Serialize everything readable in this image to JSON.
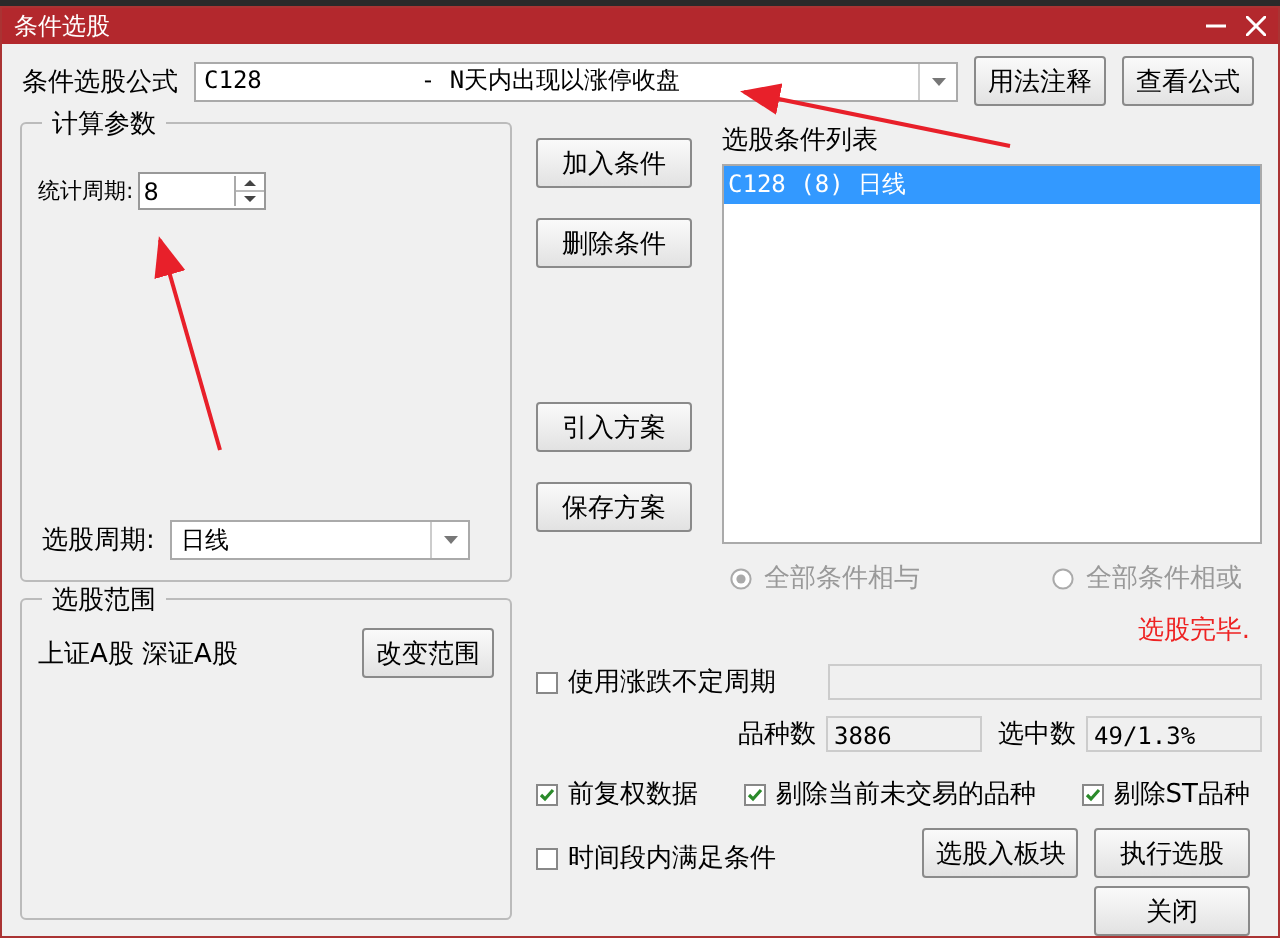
{
  "window": {
    "title": "条件选股"
  },
  "formula": {
    "label": "条件选股公式",
    "value": "C128           - N天内出现以涨停收盘",
    "buttons": [
      "用法注释",
      "查看公式"
    ]
  },
  "params": {
    "title": "计算参数",
    "fields": [
      {
        "label": "统计周期:",
        "value": "8"
      }
    ],
    "period": {
      "label": "选股周期:",
      "value": "日线"
    }
  },
  "scope": {
    "title": "选股范围",
    "text": "上证A股 深证A股",
    "button": "改变范围"
  },
  "actions": [
    "加入条件",
    "删除条件",
    "引入方案",
    "保存方案"
  ],
  "conditions": {
    "title": "选股条件列表",
    "items": [
      {
        "text": "C128 (8) 日线",
        "selected": true
      }
    ]
  },
  "logic": [
    {
      "label": "全部条件相与",
      "selected": true,
      "disabled": true
    },
    {
      "label": "全部条件相或",
      "selected": false,
      "disabled": true
    }
  ],
  "status": "选股完毕.",
  "variable_period": {
    "label": "使用涨跌不定周期",
    "checked": false
  },
  "counts": [
    {
      "label": "品种数",
      "value": "3886"
    },
    {
      "label": "选中数",
      "value": "49/1.3%"
    }
  ],
  "checks": [
    {
      "label": "前复权数据",
      "checked": true
    },
    {
      "label": "剔除当前未交易的品种",
      "checked": true
    },
    {
      "label": "剔除ST品种",
      "checked": true
    }
  ],
  "time_check": {
    "label": "时间段内满足条件",
    "checked": false
  },
  "buttons": [
    "选股入板块",
    "执行选股",
    "关闭"
  ]
}
